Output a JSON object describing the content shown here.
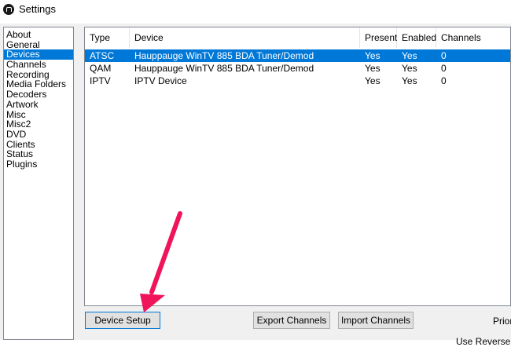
{
  "window": {
    "title": "Settings",
    "icon": "app-logo-icon"
  },
  "sidebar": {
    "items": [
      {
        "label": "About",
        "selected": false
      },
      {
        "label": "General",
        "selected": false
      },
      {
        "label": "Devices",
        "selected": true
      },
      {
        "label": "Channels",
        "selected": false
      },
      {
        "label": "Recording",
        "selected": false
      },
      {
        "label": "Media Folders",
        "selected": false
      },
      {
        "label": "Decoders",
        "selected": false
      },
      {
        "label": "Artwork",
        "selected": false
      },
      {
        "label": "Misc",
        "selected": false
      },
      {
        "label": "Misc2",
        "selected": false
      },
      {
        "label": "DVD",
        "selected": false
      },
      {
        "label": "Clients",
        "selected": false
      },
      {
        "label": "Status",
        "selected": false
      },
      {
        "label": "Plugins",
        "selected": false
      }
    ]
  },
  "devices": {
    "columns": [
      "Type",
      "Device",
      "Present",
      "Enabled",
      "Channels"
    ],
    "rows": [
      {
        "type": "ATSC",
        "device": "Hauppauge WinTV 885 BDA Tuner/Demod",
        "present": "Yes",
        "enabled": "Yes",
        "channels": "0",
        "selected": true
      },
      {
        "type": "QAM",
        "device": "Hauppauge WinTV 885 BDA Tuner/Demod",
        "present": "Yes",
        "enabled": "Yes",
        "channels": "0",
        "selected": false
      },
      {
        "type": "IPTV",
        "device": "IPTV Device",
        "present": "Yes",
        "enabled": "Yes",
        "channels": "0",
        "selected": false
      }
    ]
  },
  "buttons": {
    "device_setup": "Device Setup",
    "export_channels": "Export Channels",
    "import_channels": "Import Channels"
  },
  "labels": {
    "priority": "Priori",
    "reverse": "Use Reverse P"
  },
  "colors": {
    "selection": "#0078d7",
    "annotation_arrow": "#f0145a"
  }
}
